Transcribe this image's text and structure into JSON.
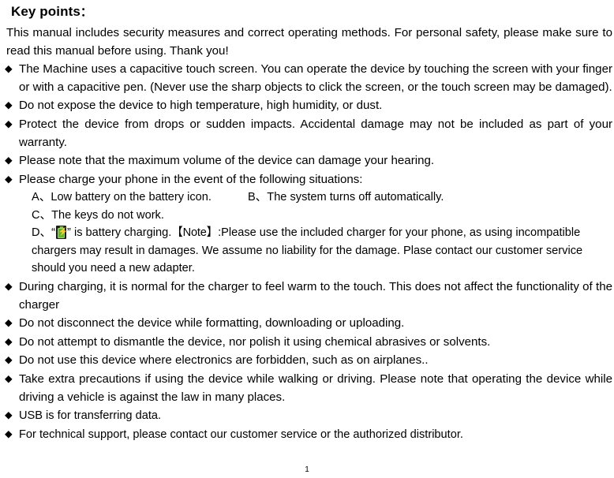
{
  "document": {
    "heading": "Key points",
    "heading_colon": "：",
    "bullet_glyph": "◆",
    "intro": "This manual includes security measures and correct operating methods. For personal safety, please make sure to read this manual before using. Thank you!",
    "bullets": [
      "The Machine uses a capacitive touch screen. You can operate the device by touching the screen with your finger or with a capacitive pen. (Never use the sharp objects to click the screen, or the touch screen may be damaged).",
      "Do not expose the device to high temperature, high humidity, or dust.",
      "Protect the device from drops or sudden impacts. Accidental damage may not be included as part of your warranty.",
      "Please note that the maximum volume of the device can damage your hearing.",
      "Please charge your phone in the event of the following situations:"
    ],
    "charge_situations": {
      "a_label": "A、",
      "a_text": "Low battery on the battery icon.",
      "b_label": "B、",
      "b_text": "The system turns off automatically.",
      "c_label": "C、",
      "c_text": "The keys do not work.",
      "d_label": "D、",
      "d_quote_open": "“",
      "d_quote_close": "”",
      "d_text": " is battery charging.",
      "battery_icon": "battery-charging-icon"
    },
    "note": {
      "marker": "【Note】",
      "text": ":Please use the included charger for your phone, as using incompatible chargers may result in damages. We assume no liability for the damage. Plase contact our customer service should you need a new adapter."
    },
    "bullets_after": [
      "During charging, it is normal for the charger to feel warm to the touch. This does not affect the functionality of the charger",
      "Do not disconnect the device while formatting, downloading or uploading.",
      "Do not attempt to dismantle the device, nor polish it using chemical abrasives or solvents.",
      "Do not use this device where electronics are forbidden, such as on airplanes..",
      "Take extra precautions if using the device while walking or driving. Please note that operating the device while driving a vehicle is against the law in many places.",
      "USB is for transferring data.",
      "For technical support, please contact our customer service or the authorized distributor."
    ],
    "page_number": "1"
  }
}
